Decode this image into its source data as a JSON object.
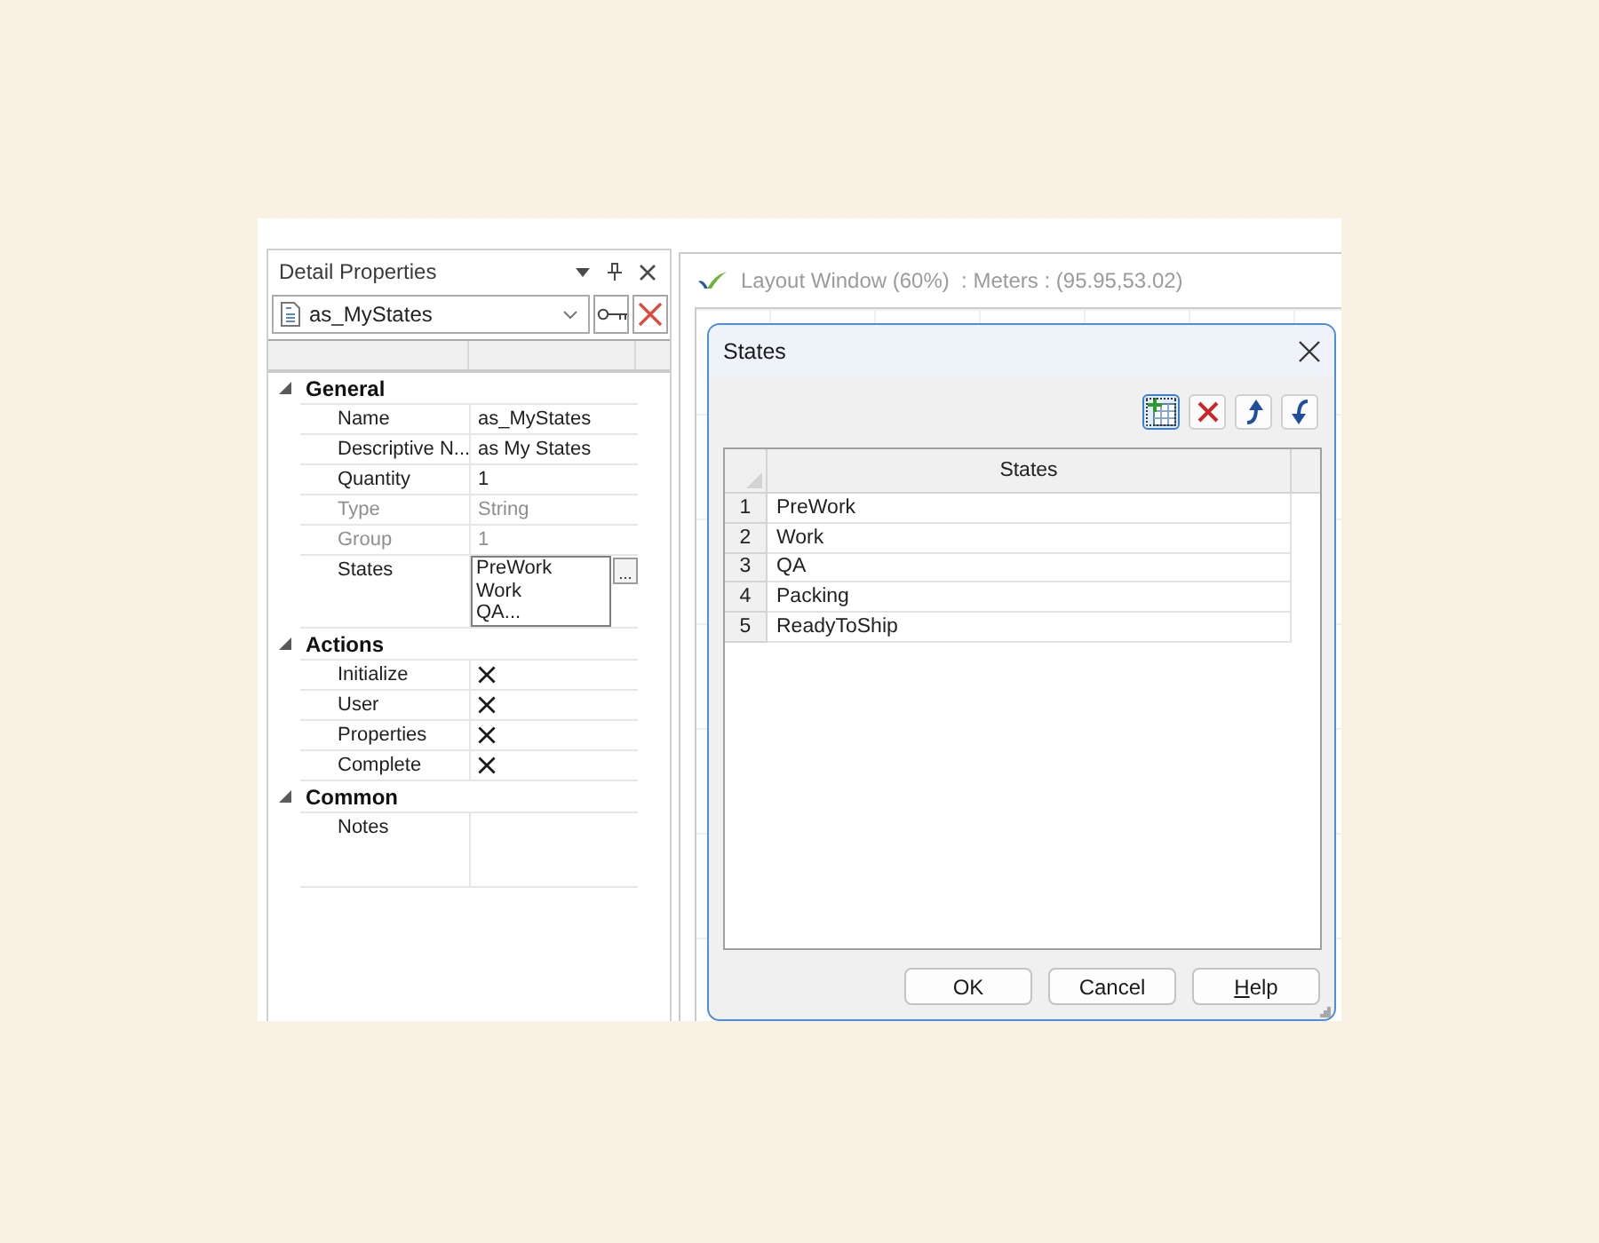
{
  "properties_panel": {
    "title": "Detail Properties",
    "object_selector": {
      "value": "as_MyStates"
    },
    "categories": [
      {
        "name": "General",
        "expanded": true,
        "rows": [
          {
            "kind": "text",
            "label": "Name",
            "value": "as_MyStates",
            "disabled": false
          },
          {
            "kind": "text",
            "label": "Descriptive N...",
            "value": "as My States",
            "disabled": false
          },
          {
            "kind": "text",
            "label": "Quantity",
            "value": "1",
            "disabled": false
          },
          {
            "kind": "text",
            "label": "Type",
            "value": "String",
            "disabled": true
          },
          {
            "kind": "text",
            "label": "Group",
            "value": "1",
            "disabled": true
          },
          {
            "kind": "list",
            "label": "States",
            "lines": [
              "PreWork",
              "Work",
              "QA..."
            ],
            "button": "...",
            "disabled": false
          }
        ]
      },
      {
        "name": "Actions",
        "expanded": true,
        "rows": [
          {
            "kind": "cross",
            "label": "Initialize",
            "disabled": false
          },
          {
            "kind": "cross",
            "label": "User",
            "disabled": false
          },
          {
            "kind": "cross",
            "label": "Properties",
            "disabled": false
          },
          {
            "kind": "cross",
            "label": "Complete",
            "disabled": false
          }
        ]
      },
      {
        "name": "Common",
        "expanded": true,
        "rows": [
          {
            "kind": "memo",
            "label": "Notes",
            "disabled": false
          }
        ]
      }
    ]
  },
  "layout_window": {
    "title": "Layout Window (60%)  : Meters : (95.95,53.02)"
  },
  "dialog": {
    "title": "States",
    "toolbar": [
      {
        "kind": "add",
        "focused": true
      },
      {
        "kind": "delete",
        "focused": false
      },
      {
        "kind": "up",
        "focused": false
      },
      {
        "kind": "down",
        "focused": false
      }
    ],
    "grid": {
      "column": "States",
      "rows": [
        {
          "number": "1",
          "value": "PreWork"
        },
        {
          "number": "2",
          "value": "Work"
        },
        {
          "number": "3",
          "value": "QA"
        },
        {
          "number": "4",
          "value": "Packing"
        },
        {
          "number": "5",
          "value": "ReadyToShip"
        }
      ]
    },
    "buttons": [
      {
        "label": "OK",
        "access_key": false
      },
      {
        "label": "Cancel",
        "access_key": false
      },
      {
        "label": "Help",
        "access_key": true
      }
    ]
  }
}
